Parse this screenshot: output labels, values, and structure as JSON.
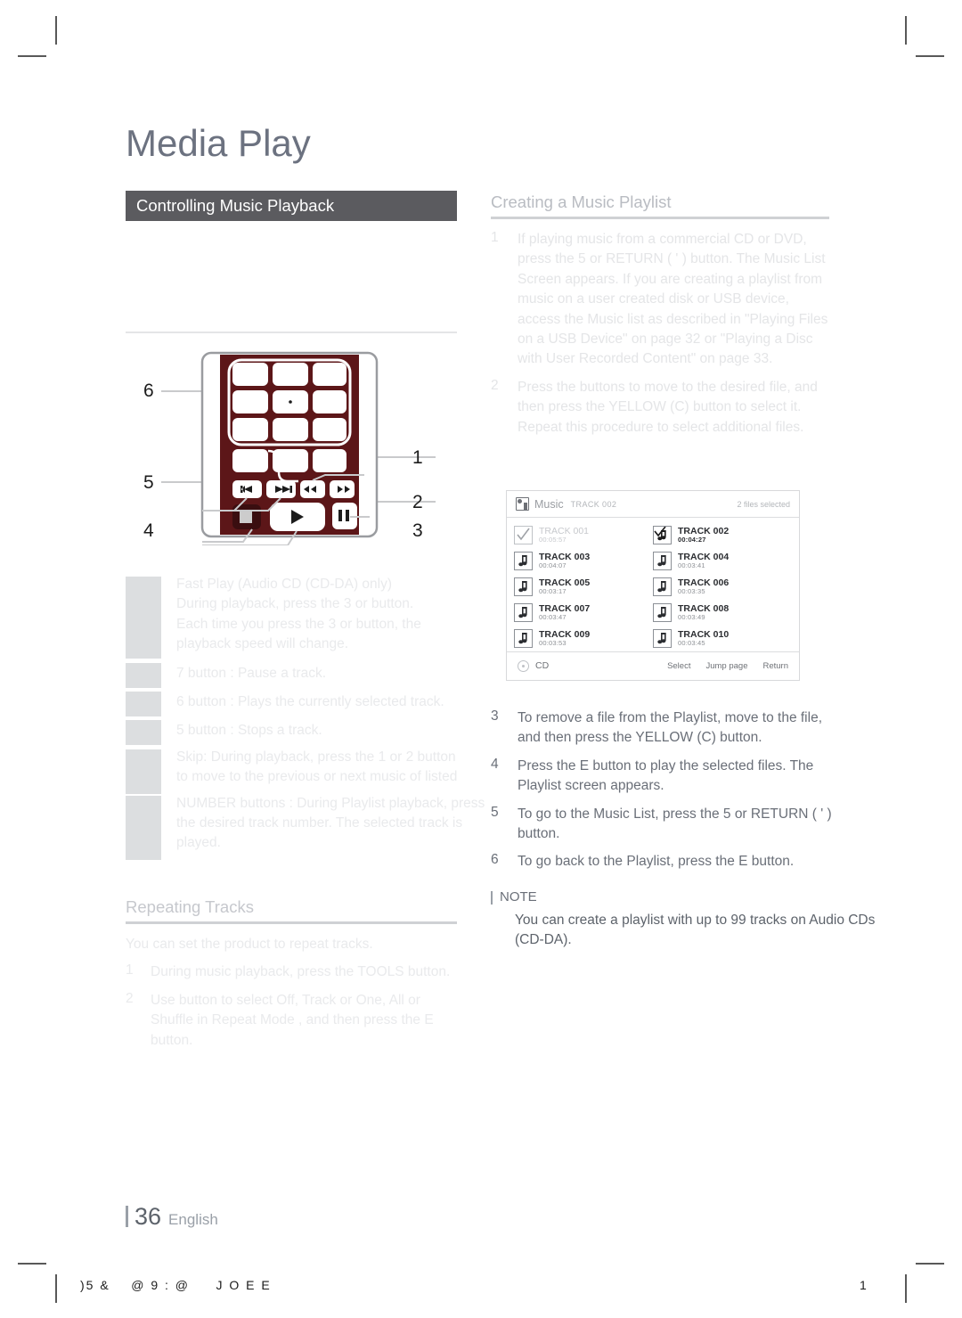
{
  "page": {
    "masthead_title": "Media Play",
    "footer_page_number": "36",
    "footer_language": "English",
    "footer_garbled": ")5 &    @ 9 : @     J O E E",
    "footer_right_number": "1"
  },
  "left_column": {
    "banner_title": "Controlling Music Playback",
    "remote": {
      "callouts": [
        "1",
        "2",
        "3",
        "4",
        "5",
        "6"
      ],
      "button_icons": [
        "skip-back-icon",
        "skip-forward-icon",
        "rewind-icon",
        "fast-forward-icon",
        "stop-icon",
        "play-icon",
        "pause-icon"
      ]
    },
    "faded_items": [
      {
        "lines": [
          "Fast Play (Audio CD (CD-DA) only)",
          "During playback, press the 3 or button.",
          "Each time you press the 3 or button, the",
          "playback speed will change."
        ]
      },
      {
        "lines": [
          "7   button : Pause a track."
        ]
      },
      {
        "lines": [
          "6   button : Plays the currently selected track."
        ]
      },
      {
        "lines": [
          "5   button : Stops a track."
        ]
      },
      {
        "lines": [
          "Skip: During playback, press the 1 or 2 button",
          "to move to the previous or next music of listed"
        ]
      },
      {
        "lines": [
          "NUMBER buttons : During Playlist playback, press",
          "the desired track number. The selected track is",
          "played."
        ]
      }
    ],
    "repeating": {
      "heading": "Repeating Tracks",
      "intro": "You can set the product to repeat tracks.",
      "steps": [
        {
          "num": "1",
          "text": "During music playback, press the TOOLS button."
        },
        {
          "num": "2",
          "text": "Use   button to select Off, Track or One, All or Shuffle in Repeat Mode , and then press the E  button."
        }
      ]
    }
  },
  "right_column": {
    "heading": "Creating a Music Playlist",
    "steps_top": [
      {
        "num": "1",
        "text": "If playing music from a commercial CD or DVD, press the 5 or RETURN ( ' ) button. The Music List Screen appears. If you are creating a playlist from music on a user created disk or USB device, access the Music list as described in \"Playing Files on a USB Device\" on page 32 or \"Playing a Disc with User Recorded Content\" on page 33."
      },
      {
        "num": "2",
        "text": "Press the   buttons to move to the desired file, and then press the YELLOW (C) button to select it. Repeat this procedure to select additional files."
      }
    ],
    "steps_bottom": [
      {
        "num": "3",
        "text": "To remove a file from the Playlist, move to the file, and then press the YELLOW (C) button."
      },
      {
        "num": "4",
        "text": "Press the E  button to play the selected files. The Playlist screen appears."
      },
      {
        "num": "5",
        "text": "To go to the Music List, press the 5  or RETURN ( ' ) button."
      },
      {
        "num": "6",
        "text": "To go back to the Playlist, press the E button."
      }
    ],
    "note": {
      "label": "NOTE",
      "text": "You can create a playlist with up to 99 tracks on Audio CDs (CD-DA)."
    }
  },
  "music_screen": {
    "app_title": "Music",
    "now_playing": "TRACK 002",
    "selected_count": "2 files selected",
    "tracks_left": [
      {
        "name": "TRACK 001",
        "time": "00:05:57",
        "checked": true,
        "icon": "checkbox-icon",
        "style": "dim"
      },
      {
        "name": "TRACK 003",
        "time": "00:04:07",
        "checked": false,
        "icon": "music-note-icon",
        "style": "normal"
      },
      {
        "name": "TRACK 005",
        "time": "00:03:17",
        "checked": false,
        "icon": "music-note-icon",
        "style": "normal"
      },
      {
        "name": "TRACK 007",
        "time": "00:03:47",
        "checked": false,
        "icon": "music-note-icon",
        "style": "normal"
      },
      {
        "name": "TRACK 009",
        "time": "00:03:53",
        "checked": false,
        "icon": "music-note-icon",
        "style": "normal"
      }
    ],
    "tracks_right": [
      {
        "name": "TRACK 002",
        "time": "00:04:27",
        "checked": true,
        "icon": "music-note-checked-icon",
        "style": "bold"
      },
      {
        "name": "TRACK 004",
        "time": "00:03:41",
        "checked": false,
        "icon": "music-note-icon",
        "style": "bold-name"
      },
      {
        "name": "TRACK 006",
        "time": "00:03:35",
        "checked": false,
        "icon": "music-note-icon",
        "style": "normal"
      },
      {
        "name": "TRACK 008",
        "time": "00:03:49",
        "checked": false,
        "icon": "music-note-icon",
        "style": "normal"
      },
      {
        "name": "TRACK 010",
        "time": "00:03:45",
        "checked": false,
        "icon": "music-note-icon",
        "style": "normal"
      }
    ],
    "footer": {
      "source_label": "CD",
      "actions": [
        "Select",
        "Jump page",
        "Return"
      ]
    }
  },
  "colors": {
    "banner_bg": "#5b5b5f",
    "heading_gray": "#6c7280",
    "faded_text": "#e9eaec",
    "remote_body": "#5c1618",
    "rule": "#cfd1d4"
  }
}
